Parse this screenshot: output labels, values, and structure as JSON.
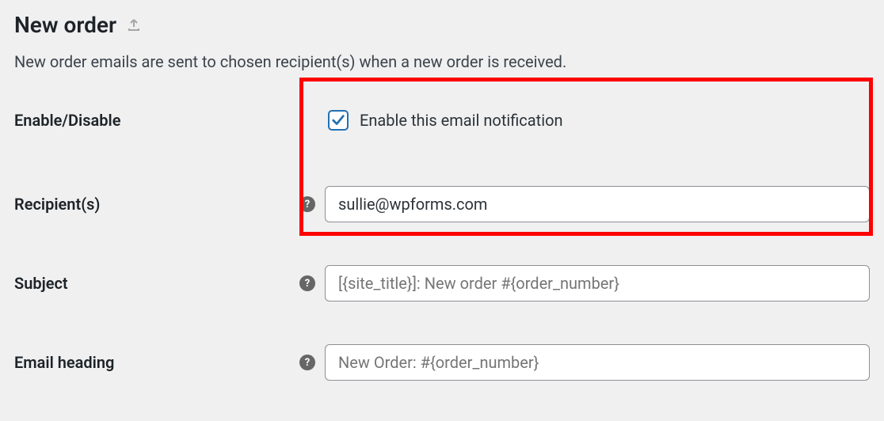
{
  "header": {
    "title": "New order"
  },
  "description": "New order emails are sent to chosen recipient(s) when a new order is received.",
  "fields": {
    "enable": {
      "label": "Enable/Disable",
      "checkbox_label": "Enable this email notification",
      "checked": true
    },
    "recipients": {
      "label": "Recipient(s)",
      "value": "sullie@wpforms.com"
    },
    "subject": {
      "label": "Subject",
      "placeholder": "[{site_title}]: New order #{order_number}"
    },
    "email_heading": {
      "label": "Email heading",
      "placeholder": "New Order: #{order_number}"
    }
  }
}
